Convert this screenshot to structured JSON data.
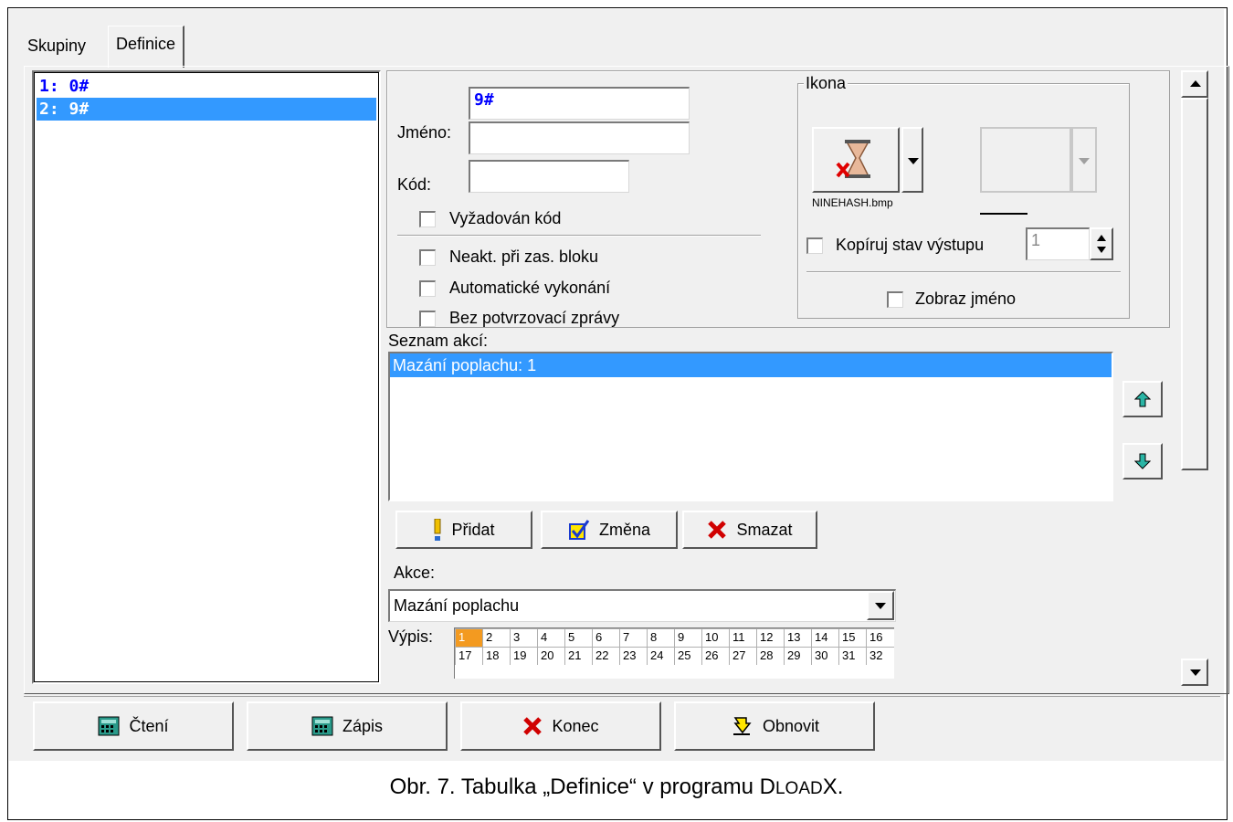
{
  "tabs": [
    {
      "label": "Skupiny"
    },
    {
      "label": "Definice"
    }
  ],
  "macro_list": [
    {
      "label": "1: 0#",
      "selected": false
    },
    {
      "label": "2: 9#",
      "selected": true
    }
  ],
  "form": {
    "name_label": "Jméno:",
    "name_line1": "9#",
    "name_line2": "",
    "code_label": "Kód:",
    "code_value": "",
    "code_required_label": "Vyžadován kód",
    "inactive_block_label": "Neakt. při zas. bloku",
    "auto_exec_label": "Automatické vykonání",
    "no_confirm_label": "Bez potvrzovací zprávy"
  },
  "icon_group": {
    "title": "Ikona",
    "icon_file": "NINEHASH.bmp",
    "icon_name": "hourglass-icon",
    "copy_output_label": "Kopíruj stav výstupu",
    "copy_output_value": "1",
    "show_name_label": "Zobraz jméno"
  },
  "actions": {
    "label": "Seznam akcí:",
    "items": [
      {
        "label": "Mazání poplachu: 1",
        "selected": true
      }
    ],
    "add_label": "Přidat",
    "change_label": "Změna",
    "delete_label": "Smazat",
    "action_label": "Akce:",
    "action_value": "Mazání poplachu",
    "outputs_label": "Výpis:",
    "outputs_row1": [
      "1",
      "2",
      "3",
      "4",
      "5",
      "6",
      "7",
      "8",
      "9",
      "10",
      "11",
      "12",
      "13",
      "14",
      "15",
      "16"
    ],
    "outputs_row2": [
      "17",
      "18",
      "19",
      "20",
      "21",
      "22",
      "23",
      "24",
      "25",
      "26",
      "27",
      "28",
      "29",
      "30",
      "31",
      "32"
    ],
    "outputs_selected": "1"
  },
  "footer": {
    "read_label": "Čtení",
    "write_label": "Zápis",
    "close_label": "Konec",
    "refresh_label": "Obnovit"
  },
  "caption": {
    "prefix": "Obr. 7. Tabulka „Definice“ v programu ",
    "program_d": "D",
    "program_rest": "LOAD",
    "program_x": "X",
    "suffix": "."
  },
  "colors": {
    "selection": "#3399ff",
    "list_text": "#0000ff",
    "output_highlight": "#f39a20"
  }
}
